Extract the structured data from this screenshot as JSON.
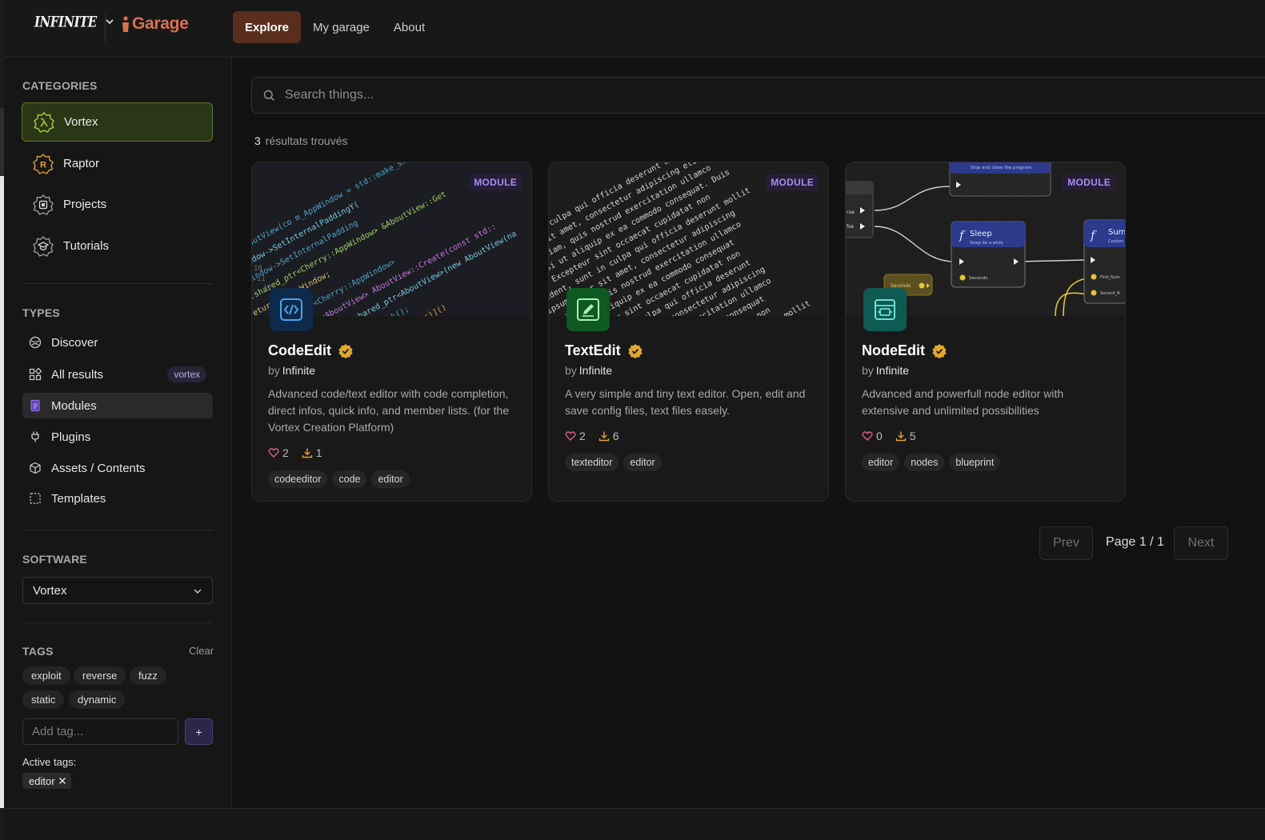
{
  "header": {
    "brand_logo": "INFINITE",
    "app_name": "Garage",
    "nav": [
      {
        "label": "Explore",
        "active": true
      },
      {
        "label": "My garage",
        "active": false
      },
      {
        "label": "About",
        "active": false
      }
    ]
  },
  "sidebar": {
    "categories_title": "CATEGORIES",
    "categories": [
      {
        "label": "Vortex",
        "icon": "vortex-lambda-icon",
        "active": true
      },
      {
        "label": "Raptor",
        "icon": "raptor-r-icon",
        "active": false
      },
      {
        "label": "Projects",
        "icon": "projects-icon",
        "active": false
      },
      {
        "label": "Tutorials",
        "icon": "tutorials-icon",
        "active": false
      }
    ],
    "types_title": "TYPES",
    "types": [
      {
        "label": "Discover",
        "icon": "compass-icon",
        "active": false
      },
      {
        "label": "All results",
        "icon": "grid-icon",
        "active": false,
        "badge": "vortex"
      },
      {
        "label": "Modules",
        "icon": "module-icon",
        "active": true
      },
      {
        "label": "Plugins",
        "icon": "plug-icon",
        "active": false
      },
      {
        "label": "Assets / Contents",
        "icon": "cube-icon",
        "active": false
      },
      {
        "label": "Templates",
        "icon": "template-icon",
        "active": false
      }
    ],
    "software_title": "SOFTWARE",
    "software_selected": "Vortex",
    "tags_title": "TAGS",
    "tags_clear": "Clear",
    "tags": [
      "exploit",
      "reverse",
      "fuzz",
      "static",
      "dynamic"
    ],
    "add_tag_placeholder": "Add tag...",
    "add_tag_button": "+",
    "active_tags_label": "Active tags:",
    "active_tags": [
      "editor"
    ]
  },
  "main": {
    "search_placeholder": "Search things...",
    "results_count": "3",
    "results_label": "résultats trouvés",
    "cards": [
      {
        "title": "CodeEdit",
        "badge": "MODULE",
        "by_label": "by",
        "author": "Infinite",
        "description": "Advanced code/text editor with code completion, direct infos, quick info, and member lists. (for the Vortex Creation Platform)",
        "likes": "2",
        "downloads": "1",
        "tags": [
          "codeeditor",
          "code",
          "editor"
        ],
        "verified": true
      },
      {
        "title": "TextEdit",
        "badge": "MODULE",
        "by_label": "by",
        "author": "Infinite",
        "description": "A very simple and tiny text editor. Open, edit and save config files, text files easely.",
        "likes": "2",
        "downloads": "6",
        "tags": [
          "texteditor",
          "editor"
        ],
        "verified": true
      },
      {
        "title": "NodeEdit",
        "badge": "MODULE",
        "by_label": "by",
        "author": "Infinite",
        "description": "Advanced and powerfull node editor with extensive and unlimited possibilities",
        "likes": "0",
        "downloads": "5",
        "tags": [
          "editor",
          "nodes",
          "blueprint"
        ],
        "verified": true
      }
    ],
    "pagination": {
      "prev": "Prev",
      "page_text": "Page 1 / 1",
      "next": "Next"
    }
  },
  "colors": {
    "accent_orange": "#d9714f",
    "explore_active_bg": "#5a2e1c",
    "vortex_active_bg": "#2a3616",
    "module_badge": "#a98cf2",
    "verified_gold": "#e0a82e",
    "like_pink": "#e05a8a",
    "download_orange": "#e0a030"
  },
  "node_preview": {
    "node1_subtitle": "Stop and close the program",
    "node2_title": "Sleep",
    "node2_subtitle": "Sleep for a while",
    "node2_pin": "Seconds",
    "node3_title": "Sum",
    "node3_subtitle": "Custom",
    "node3_pin1": "First_Num",
    "node3_pin2": "Second_N",
    "left_pin1": "rue",
    "left_pin2": "fse",
    "yellow_node": "Seconds"
  }
}
